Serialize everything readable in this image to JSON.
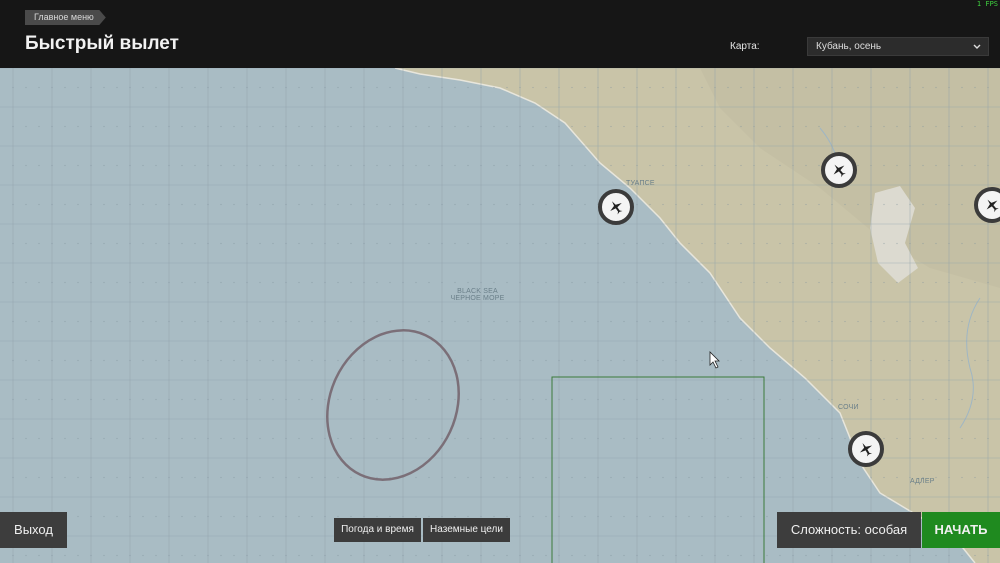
{
  "header": {
    "breadcrumb": "Главное меню",
    "title": "Быстрый вылет",
    "map_label": "Карта:",
    "map_value": "Кубань, осень",
    "fps": "1 FPS"
  },
  "map": {
    "sea_label_en": "BLACK SEA",
    "sea_label_ru": "ЧЕРНОЕ МОРЕ",
    "colors": {
      "sea": "#a9bcc4",
      "land": "#c9c4a8",
      "grid": "#93a7b0",
      "zone_ellipse": "#7b6f78",
      "zone_green": "#3a7a3a"
    },
    "airfields": [
      {
        "name": "airfield-tuapse",
        "icon": "plane-icon"
      },
      {
        "name": "airfield-north",
        "icon": "plane-icon"
      },
      {
        "name": "airfield-east-edge",
        "icon": "plane-icon"
      },
      {
        "name": "airfield-adler",
        "icon": "plane-icon"
      }
    ],
    "towns": [
      "ТУАПСЕ",
      "СОЧИ",
      "АДЛЕР"
    ]
  },
  "buttons": {
    "exit": "Выход",
    "weather": "Погода и время",
    "targets": "Наземные цели",
    "difficulty": "Сложность: особая",
    "start": "НАЧАТЬ"
  }
}
